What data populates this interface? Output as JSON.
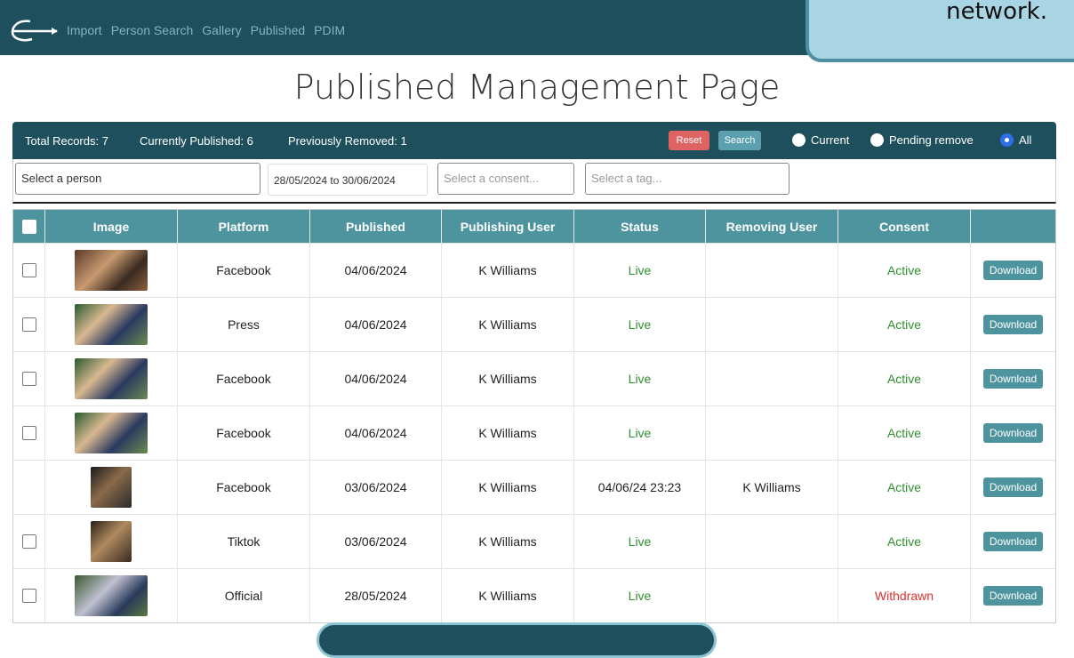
{
  "nav": {
    "items": [
      "Import",
      "Person Search",
      "Gallery",
      "Published",
      "PDIM"
    ]
  },
  "callout": {
    "text": "network."
  },
  "page": {
    "title": "Published Management Page"
  },
  "toolbar": {
    "total": "Total Records: 7",
    "published": "Currently Published: 6",
    "removed": "Previously Removed: 1",
    "reset": "Reset",
    "search": "Search",
    "radios": [
      "Current",
      "Pending remove",
      "All"
    ],
    "selected_radio": "All"
  },
  "filters": {
    "person_placeholder": "Select a person",
    "date_range": "28/05/2024 to 30/06/2024",
    "consent_placeholder": "Select a consent...",
    "tag_placeholder": "Select a tag..."
  },
  "table": {
    "headers": [
      "Image",
      "Platform",
      "Published",
      "Publishing User",
      "Status",
      "Removing User",
      "Consent"
    ],
    "download_label": "Download",
    "rows": [
      {
        "platform": "Facebook",
        "published": "04/06/2024",
        "user": "K Williams",
        "status": "Live",
        "removing": "",
        "consent": "Active",
        "checkbox": true
      },
      {
        "platform": "Press",
        "published": "04/06/2024",
        "user": "K Williams",
        "status": "Live",
        "removing": "",
        "consent": "Active",
        "checkbox": true
      },
      {
        "platform": "Facebook",
        "published": "04/06/2024",
        "user": "K Williams",
        "status": "Live",
        "removing": "",
        "consent": "Active",
        "checkbox": true
      },
      {
        "platform": "Facebook",
        "published": "04/06/2024",
        "user": "K Williams",
        "status": "Live",
        "removing": "",
        "consent": "Active",
        "checkbox": true
      },
      {
        "platform": "Facebook",
        "published": "03/06/2024",
        "user": "K Williams",
        "status": "04/06/24 23:23",
        "removing": "K Williams",
        "consent": "Active",
        "checkbox": false
      },
      {
        "platform": "Tiktok",
        "published": "03/06/2024",
        "user": "K Williams",
        "status": "Live",
        "removing": "",
        "consent": "Active",
        "checkbox": true
      },
      {
        "platform": "Official",
        "published": "28/05/2024",
        "user": "K Williams",
        "status": "Live",
        "removing": "",
        "consent": "Withdrawn",
        "checkbox": true
      }
    ]
  },
  "colors": {
    "nav": "#1e4f5c",
    "header": "#4e949f",
    "live": "#2f8f2f",
    "withdrawn": "#e03030",
    "reset": "#e06363"
  }
}
